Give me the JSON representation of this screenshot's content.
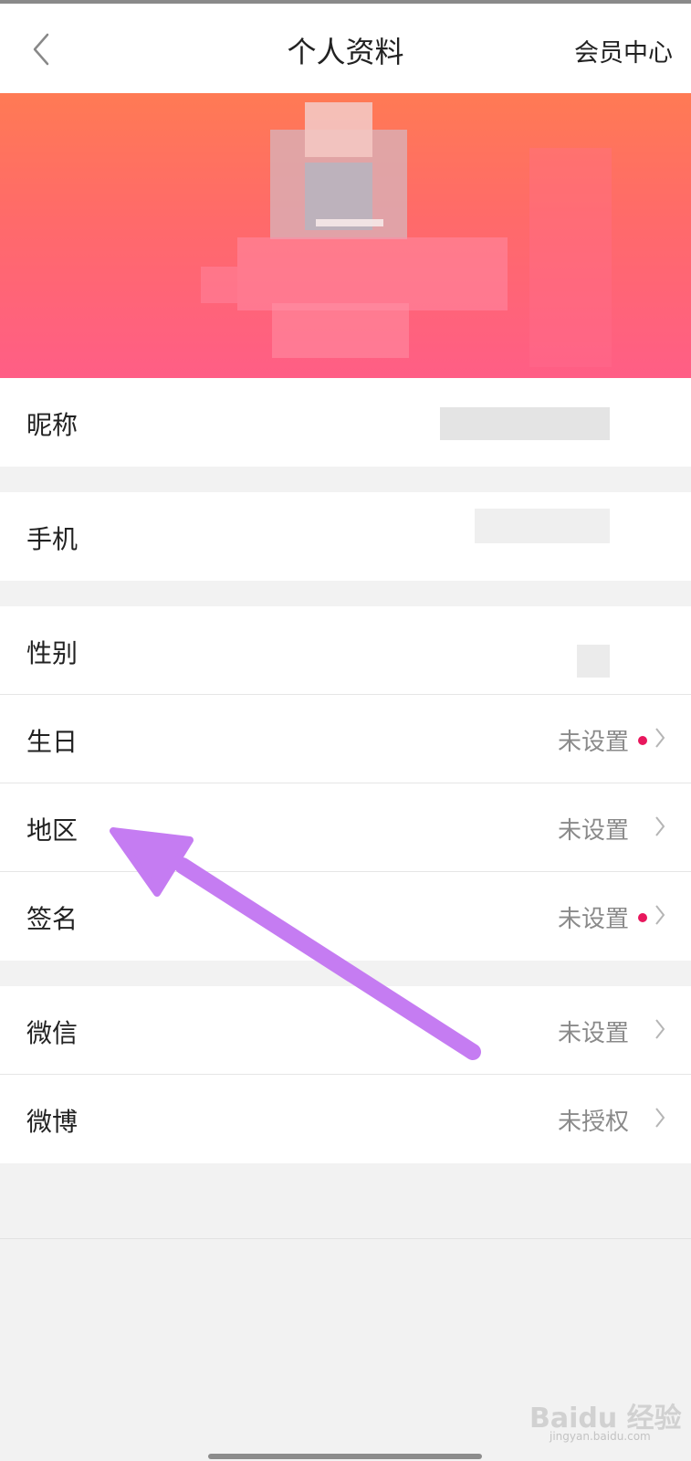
{
  "header": {
    "title": "个人资料",
    "right_link": "会员中心",
    "back_icon": "chevron-left-icon"
  },
  "rows": [
    {
      "label": "昵称",
      "value": "",
      "redacted": true
    },
    {
      "label": "手机",
      "value": "",
      "redacted": true
    },
    {
      "label": "性别",
      "value": "",
      "redacted": true
    },
    {
      "label": "生日",
      "value": "未设置",
      "badge": true
    },
    {
      "label": "地区",
      "value": "未设置"
    },
    {
      "label": "签名",
      "value": "未设置",
      "badge": true
    },
    {
      "label": "微信",
      "value": "未设置"
    },
    {
      "label": "微博",
      "value": "未授权"
    }
  ],
  "watermark": {
    "text": "Baidu 经验",
    "sub": "jingyan.baidu.com"
  },
  "colors": {
    "banner_top": "#ff7a54",
    "banner_bottom": "#ff5e86",
    "badge": "#e8175d",
    "arrow": "#c57cf2"
  }
}
